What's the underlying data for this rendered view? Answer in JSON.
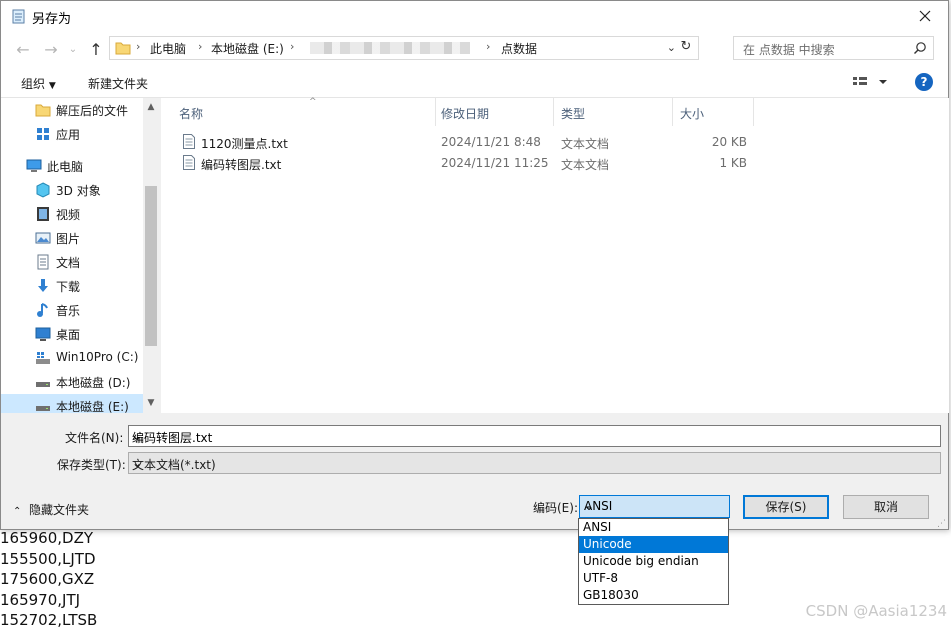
{
  "window": {
    "title": "另存为"
  },
  "nav": {
    "breadcrumb": [
      "此电脑",
      "本地磁盘 (E:)",
      "点数据"
    ],
    "search_placeholder": "在 点数据 中搜索"
  },
  "toolbar": {
    "organize_label": "组织",
    "new_folder_label": "新建文件夹"
  },
  "sidebar": {
    "items": [
      {
        "label": "解压后的文件",
        "icon": "folder-icon"
      },
      {
        "label": "应用",
        "icon": "apps-icon"
      },
      {
        "label": "此电脑",
        "icon": "computer-icon"
      },
      {
        "label": "3D 对象",
        "icon": "3d-objects-icon"
      },
      {
        "label": "视频",
        "icon": "video-icon"
      },
      {
        "label": "图片",
        "icon": "pictures-icon"
      },
      {
        "label": "文档",
        "icon": "documents-icon"
      },
      {
        "label": "下载",
        "icon": "downloads-icon"
      },
      {
        "label": "音乐",
        "icon": "music-icon"
      },
      {
        "label": "桌面",
        "icon": "desktop-icon"
      },
      {
        "label": "Win10Pro (C:)",
        "icon": "system-drive-icon"
      },
      {
        "label": "本地磁盘 (D:)",
        "icon": "drive-icon"
      },
      {
        "label": "本地磁盘 (E:)",
        "icon": "drive-icon"
      }
    ],
    "selected_index": 12
  },
  "filelist": {
    "columns": [
      "名称",
      "修改日期",
      "类型",
      "大小"
    ],
    "rows": [
      {
        "name": "1120测量点.txt",
        "date": "2024/11/21 8:48",
        "type": "文本文档",
        "size": "20 KB"
      },
      {
        "name": "编码转图层.txt",
        "date": "2024/11/21 11:25",
        "type": "文本文档",
        "size": "1 KB"
      }
    ]
  },
  "form": {
    "filename_label": "文件名(N):",
    "filename_value": "编码转图层.txt",
    "filetype_label": "保存类型(T):",
    "filetype_value": "文本文档(*.txt)"
  },
  "footer": {
    "hide_folders_label": "隐藏文件夹",
    "encoding_label": "编码(E):",
    "encoding_value": "ANSI",
    "encoding_options": [
      "ANSI",
      "Unicode",
      "Unicode big endian",
      "UTF-8",
      "GB18030"
    ],
    "highlighted_option": 1,
    "save_label": "保存(S)",
    "cancel_label": "取消"
  },
  "background": {
    "lines": [
      "165960,DZY",
      "155500,LJTD",
      "175600,GXZ",
      "165970,JTJ",
      "152702,LTSB"
    ],
    "watermark": "CSDN @Aasia1234"
  },
  "colors": {
    "accent": "#0078d7",
    "selection": "#cce8ff",
    "help": "#1565c0"
  }
}
